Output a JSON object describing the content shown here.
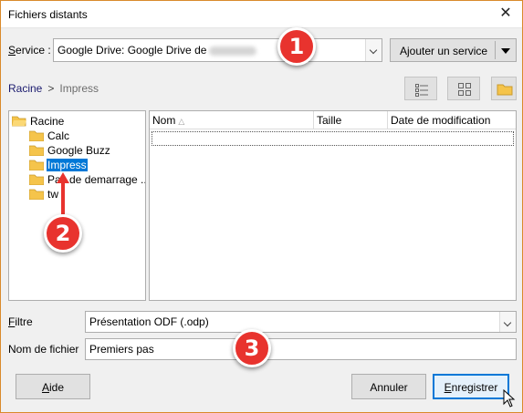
{
  "window": {
    "title": "Fichiers distants",
    "close_glyph": "✕",
    "border_color": "#d98a2b"
  },
  "service": {
    "label_first": "S",
    "label_rest": "ervice :",
    "value": "Google Drive: Google Drive de",
    "add_button": "Ajouter un service"
  },
  "breadcrumb": {
    "root": "Racine",
    "separator": ">",
    "current": "Impress"
  },
  "view_buttons": {
    "list_icon": "list-view-icon",
    "grid_icon": "grid-view-icon",
    "folder_icon": "new-folder-icon"
  },
  "tree": {
    "root": "Racine",
    "children": [
      "Calc",
      "Google Buzz",
      "Impress",
      "Pas de demarrage ...",
      "tw"
    ],
    "selected": "Impress"
  },
  "filelist": {
    "columns": [
      "Nom",
      "Taille",
      "Date de modification"
    ],
    "sort_glyph": "△"
  },
  "filter": {
    "label_first": "F",
    "label_rest": "iltre",
    "value": "Présentation ODF (.odp)"
  },
  "filename": {
    "label": "Nom de fichier",
    "value": "Premiers pas"
  },
  "buttons": {
    "help_first": "A",
    "help_rest": "ide",
    "cancel": "Annuler",
    "save_first": "E",
    "save_rest": "nregistrer"
  },
  "annotations": [
    "1",
    "2",
    "3"
  ],
  "colors": {
    "accent": "#0078d7",
    "badge_red": "#e8332e",
    "folder_yellow": "#f5c44b"
  }
}
